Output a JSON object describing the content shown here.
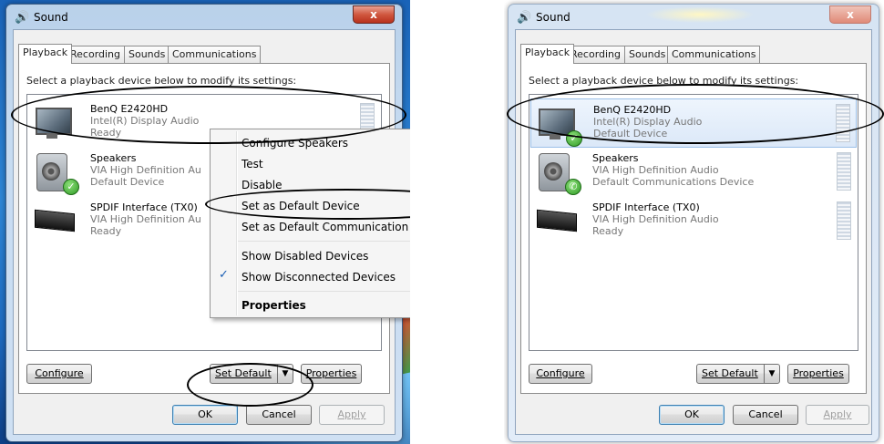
{
  "left": {
    "window": {
      "title": "Sound",
      "close_glyph": "x"
    },
    "tabs": [
      "Playback",
      "Recording",
      "Sounds",
      "Communications"
    ],
    "instruction": "Select a playback device below to modify its settings:",
    "devices": [
      {
        "name": "BenQ E2420HD",
        "driver": "Intel(R) Display Audio",
        "status": "Ready",
        "icon": "monitor-icon"
      },
      {
        "name": "Speakers",
        "driver": "VIA High Definition Au",
        "status": "Default Device",
        "icon": "speaker-icon",
        "badge": "check"
      },
      {
        "name": "SPDIF Interface (TX0)",
        "driver": "VIA High Definition Au",
        "status": "Ready",
        "icon": "spdif-icon"
      }
    ],
    "context_menu": {
      "items": [
        "Configure Speakers",
        "Test",
        "Disable",
        "Set as Default Device",
        "Set as Default Communication Device",
        "Show Disabled Devices",
        "Show Disconnected Devices",
        "Properties"
      ],
      "check_glyph": "✓"
    },
    "buttons": {
      "configure": "Configure",
      "set_default": "Set Default",
      "properties": "Properties",
      "ok": "OK",
      "cancel": "Cancel",
      "apply": "Apply"
    }
  },
  "right": {
    "window": {
      "title": "Sound",
      "close_glyph": "x"
    },
    "tabs": [
      "Playback",
      "Recording",
      "Sounds",
      "Communications"
    ],
    "instruction": "Select a playback device below to modify its settings:",
    "devices": [
      {
        "name": "BenQ E2420HD",
        "driver": "Intel(R) Display Audio",
        "status": "Default Device",
        "icon": "monitor-icon",
        "badge": "check"
      },
      {
        "name": "Speakers",
        "driver": "VIA High Definition Audio",
        "status": "Default Communications Device",
        "icon": "speaker-icon",
        "badge": "phone"
      },
      {
        "name": "SPDIF Interface (TX0)",
        "driver": "VIA High Definition Audio",
        "status": "Ready",
        "icon": "spdif-icon"
      }
    ],
    "buttons": {
      "configure": "Configure",
      "set_default": "Set Default",
      "properties": "Properties",
      "ok": "OK",
      "cancel": "Cancel",
      "apply": "Apply"
    }
  },
  "glyphs": {
    "dropdown": "▼",
    "check": "✓",
    "phone": "✆",
    "sound": "🔊"
  },
  "colors": {
    "selection": "#dbe8f8",
    "menu_bg": "#f5f5f5",
    "accent": "#1a5fb4"
  }
}
